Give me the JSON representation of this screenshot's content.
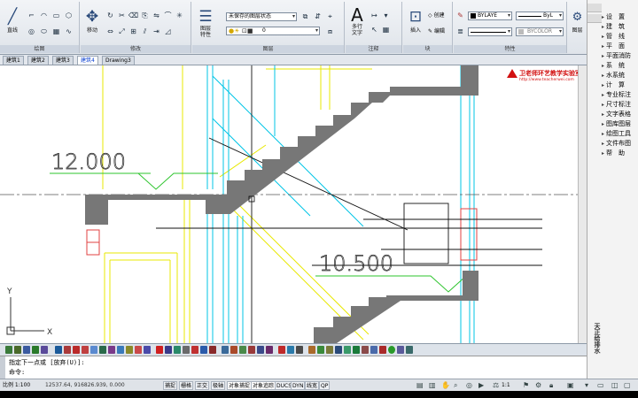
{
  "ribbon": {
    "panels": {
      "draw": "绘图",
      "modify": "修改",
      "layers": "图层",
      "annotation": "注释",
      "block": "块",
      "properties": "特性"
    },
    "line_label": "直线",
    "move_label": "移动",
    "layer_props_label": "图层\n特性",
    "layer_state_value": "未保存的图层状态",
    "layer_value": "0",
    "mtext_label": "多行\n文字",
    "insert_label": "插入",
    "create_label": "创建",
    "edit_label": "编辑",
    "color_value": "BYLAYE",
    "linetype_value": "ByL",
    "lineweight_value": "BYCOLOR",
    "groups_label": "图层",
    "a_glyph": "A"
  },
  "tabs": [
    "建筑1",
    "建筑2",
    "建筑3",
    "建筑4",
    "Drawing3"
  ],
  "active_tab": 3,
  "drawing": {
    "elev_upper": "12.000",
    "elev_lower": "10.500",
    "axis_y": "Y",
    "axis_x": "X",
    "watermark_title": "卫老师环艺教学实验室",
    "watermark_url": "http://www.teacherwei.com"
  },
  "sidebar": {
    "items": [
      "设　置",
      "建　筑",
      "管　线",
      "平　面",
      "平面消防",
      "系　统",
      "水系统",
      "计　算",
      "专业标注",
      "尺寸标注",
      "文字表格",
      "图库图层",
      "绘图工具",
      "文件布图",
      "帮　助"
    ],
    "vertical_title": "天正给排水"
  },
  "command": {
    "line1": "指定下一点或 [放弃(U)]:",
    "line2": "命令:"
  },
  "status": {
    "scale": "比例 1:100",
    "coords": "12537.64, 916826.939, 0.000",
    "toggles": [
      "捕捉",
      "栅格",
      "正交",
      "极轴",
      "对象捕捉",
      "对象追踪",
      "DUCS",
      "DYN",
      "线宽",
      "QP"
    ],
    "annotation_scale": "1:1"
  },
  "colors": {
    "stair": "#7a7a7a",
    "cyan_line": "#00c8e8",
    "yellow_line": "#f0f000",
    "green_line": "#33cc33",
    "accent_red": "#d21010"
  }
}
